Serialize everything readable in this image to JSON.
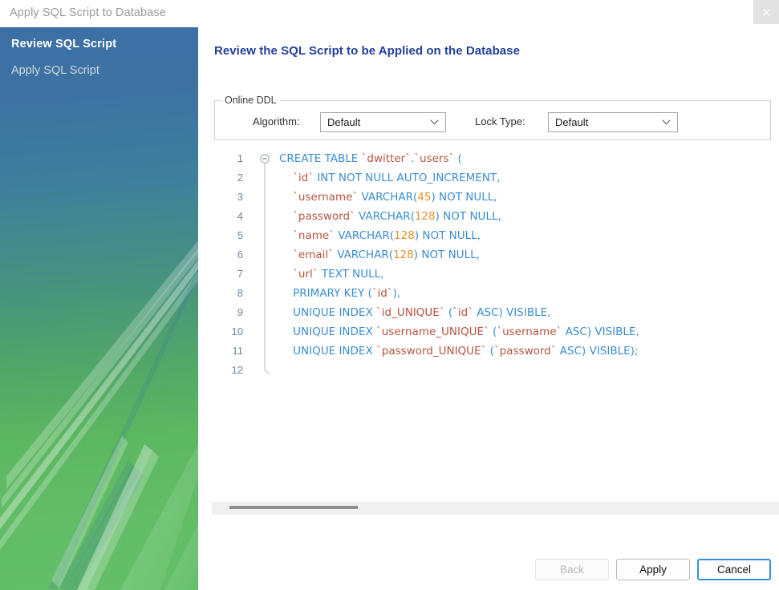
{
  "window": {
    "title": "Apply SQL Script to Database",
    "close_icon": "close-icon"
  },
  "sidebar": {
    "steps": [
      {
        "label": "Review SQL Script",
        "active": true
      },
      {
        "label": "Apply SQL Script",
        "active": false
      }
    ]
  },
  "main": {
    "heading": "Review the SQL Script to be Applied on the Database"
  },
  "online_ddl": {
    "legend": "Online DDL",
    "algorithm": {
      "label": "Algorithm:",
      "value": "Default",
      "chevron_icon": "chevron-down-icon"
    },
    "lock_type": {
      "label": "Lock Type:",
      "value": "Default",
      "chevron_icon": "chevron-down-icon"
    }
  },
  "editor": {
    "fold_icon": "fold-collapse-icon",
    "lines": [
      {
        "no": "1",
        "tokens": [
          {
            "t": "CREATE TABLE ",
            "c": "kw"
          },
          {
            "t": "`dwitter`",
            "c": "idq"
          },
          {
            "t": ".",
            "c": "pn"
          },
          {
            "t": "`users`",
            "c": "idq"
          },
          {
            "t": " (",
            "c": "pn"
          }
        ]
      },
      {
        "no": "2",
        "tokens": [
          {
            "t": "    ",
            "c": "pn"
          },
          {
            "t": "`id`",
            "c": "idq"
          },
          {
            "t": " INT NOT NULL AUTO_INCREMENT,",
            "c": "kw"
          }
        ]
      },
      {
        "no": "3",
        "tokens": [
          {
            "t": "    ",
            "c": "pn"
          },
          {
            "t": "`username`",
            "c": "idq"
          },
          {
            "t": " VARCHAR(",
            "c": "kw"
          },
          {
            "t": "45",
            "c": "num"
          },
          {
            "t": ") NOT NULL,",
            "c": "kw"
          }
        ]
      },
      {
        "no": "4",
        "tokens": [
          {
            "t": "    ",
            "c": "pn"
          },
          {
            "t": "`password`",
            "c": "idq"
          },
          {
            "t": " VARCHAR(",
            "c": "kw"
          },
          {
            "t": "128",
            "c": "num"
          },
          {
            "t": ") NOT NULL,",
            "c": "kw"
          }
        ]
      },
      {
        "no": "5",
        "tokens": [
          {
            "t": "    ",
            "c": "pn"
          },
          {
            "t": "`name`",
            "c": "idq"
          },
          {
            "t": " VARCHAR(",
            "c": "kw"
          },
          {
            "t": "128",
            "c": "num"
          },
          {
            "t": ") NOT NULL,",
            "c": "kw"
          }
        ]
      },
      {
        "no": "6",
        "tokens": [
          {
            "t": "    ",
            "c": "pn"
          },
          {
            "t": "`email`",
            "c": "idq"
          },
          {
            "t": " VARCHAR(",
            "c": "kw"
          },
          {
            "t": "128",
            "c": "num"
          },
          {
            "t": ") NOT NULL,",
            "c": "kw"
          }
        ]
      },
      {
        "no": "7",
        "tokens": [
          {
            "t": "    ",
            "c": "pn"
          },
          {
            "t": "`url`",
            "c": "idq"
          },
          {
            "t": " TEXT NULL,",
            "c": "kw"
          }
        ]
      },
      {
        "no": "8",
        "tokens": [
          {
            "t": "    PRIMARY KEY (",
            "c": "kw"
          },
          {
            "t": "`id`",
            "c": "idq"
          },
          {
            "t": "),",
            "c": "kw"
          }
        ]
      },
      {
        "no": "9",
        "tokens": [
          {
            "t": "    UNIQUE INDEX ",
            "c": "kw"
          },
          {
            "t": "`id_UNIQUE`",
            "c": "idq"
          },
          {
            "t": " (",
            "c": "kw"
          },
          {
            "t": "`id`",
            "c": "idq"
          },
          {
            "t": " ASC) VISIBLE,",
            "c": "kw"
          }
        ]
      },
      {
        "no": "10",
        "tokens": [
          {
            "t": "    UNIQUE INDEX ",
            "c": "kw"
          },
          {
            "t": "`username_UNIQUE`",
            "c": "idq"
          },
          {
            "t": " (",
            "c": "kw"
          },
          {
            "t": "`username`",
            "c": "idq"
          },
          {
            "t": " ASC) VISIBLE,",
            "c": "kw"
          }
        ]
      },
      {
        "no": "11",
        "tokens": [
          {
            "t": "    UNIQUE INDEX ",
            "c": "kw"
          },
          {
            "t": "`password_UNIQUE`",
            "c": "idq"
          },
          {
            "t": " (",
            "c": "kw"
          },
          {
            "t": "`password`",
            "c": "idq"
          },
          {
            "t": " ASC) VISIBLE);",
            "c": "kw"
          }
        ]
      },
      {
        "no": "12",
        "tokens": []
      }
    ]
  },
  "scrollbar": {
    "orientation": "horizontal"
  },
  "footer": {
    "back_label": "Back",
    "apply_label": "Apply",
    "cancel_label": "Cancel"
  },
  "colors": {
    "accent_blue": "#3a8fdc",
    "heading_blue": "#22409a",
    "sidebar_blue": "#3d6fa5",
    "sidebar_green": "#63bf68",
    "sql_keyword": "#3b8dce",
    "sql_identifier": "#b5553d",
    "sql_number": "#e5902c"
  }
}
